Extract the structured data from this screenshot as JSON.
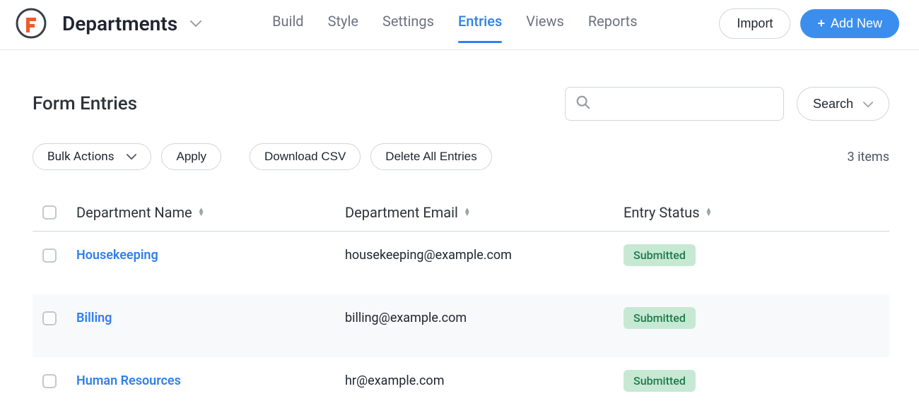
{
  "header": {
    "form_name": "Departments",
    "nav": [
      "Build",
      "Style",
      "Settings",
      "Entries",
      "Views",
      "Reports"
    ],
    "active_nav": "Entries",
    "import_label": "Import",
    "add_new_label": "Add New"
  },
  "page": {
    "title": "Form Entries",
    "bulk_label": "Bulk Actions",
    "apply_label": "Apply",
    "download_label": "Download CSV",
    "delete_all_label": "Delete All Entries",
    "search_button_label": "Search",
    "items_count": "3 items",
    "search_value": ""
  },
  "columns": {
    "c1": "Department Name",
    "c2": "Department Email",
    "c3": "Entry Status"
  },
  "rows": [
    {
      "name": "Housekeeping",
      "email": "housekeeping@example.com",
      "status": "Submitted"
    },
    {
      "name": "Billing",
      "email": "billing@example.com",
      "status": "Submitted"
    },
    {
      "name": "Human Resources",
      "email": "hr@example.com",
      "status": "Submitted"
    }
  ]
}
